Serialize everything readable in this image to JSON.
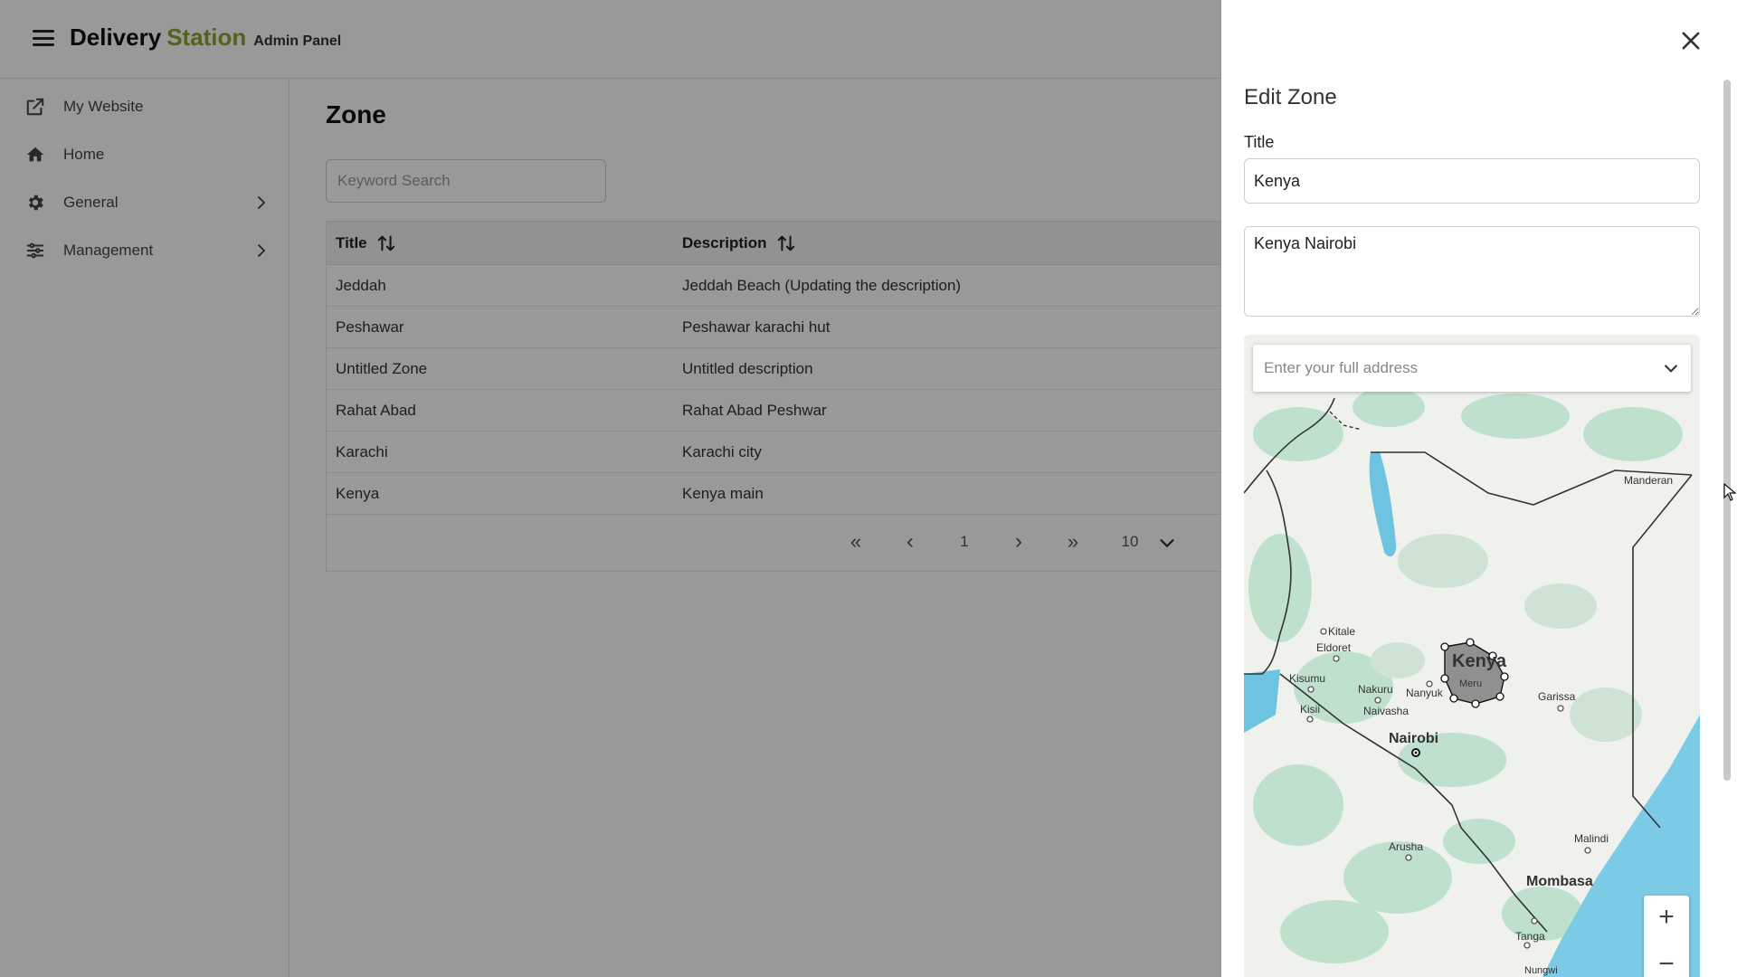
{
  "header": {
    "brand_primary": "Delivery",
    "brand_accent": "Station",
    "brand_sub": "Admin Panel",
    "accent_color": "#8aa633"
  },
  "sidebar": {
    "items": [
      {
        "label": "My Website",
        "icon": "external-link-icon"
      },
      {
        "label": "Home",
        "icon": "home-icon"
      },
      {
        "label": "General",
        "icon": "gear-icon",
        "expandable": true
      },
      {
        "label": "Management",
        "icon": "sliders-icon",
        "expandable": true
      }
    ]
  },
  "main": {
    "page_title": "Zone",
    "search_placeholder": "Keyword Search",
    "table": {
      "columns": [
        "Title",
        "Description"
      ],
      "rows": [
        {
          "title": "Jeddah",
          "description": "Jeddah Beach (Updating the description)"
        },
        {
          "title": "Peshawar",
          "description": "Peshawar karachi hut"
        },
        {
          "title": "Untitled Zone",
          "description": "Untitled description"
        },
        {
          "title": "Rahat Abad",
          "description": "Rahat Abad Peshwar"
        },
        {
          "title": "Karachi",
          "description": "Karachi city"
        },
        {
          "title": "Kenya",
          "description": "Kenya main"
        }
      ]
    },
    "pagination": {
      "first": "«",
      "prev": "‹",
      "current_page": "1",
      "next": "›",
      "last": "»",
      "page_size": "10"
    }
  },
  "drawer": {
    "title": "Edit Zone",
    "title_label": "Title",
    "title_value": "Kenya",
    "description_value": "Kenya Nairobi",
    "address_placeholder": "Enter your full address",
    "map": {
      "labels": {
        "kenya": "Kenya",
        "meru": "Meru",
        "kitale": "Kitale",
        "eldoret": "Eldoret",
        "kisumu": "Kisumu",
        "kisii": "Kisii",
        "nakuru": "Nakuru",
        "nanyuki": "Nanyuk",
        "naivasha": "Naivasha",
        "nairobi": "Nairobi",
        "garissa": "Garissa",
        "mandera": "Manderan",
        "arusha": "Arusha",
        "malindi": "Malindi",
        "mombasa": "Mombasa",
        "tanga": "Tanga",
        "nungwi": "Nungwi"
      },
      "zoom_in": "+",
      "zoom_out": "−"
    }
  }
}
